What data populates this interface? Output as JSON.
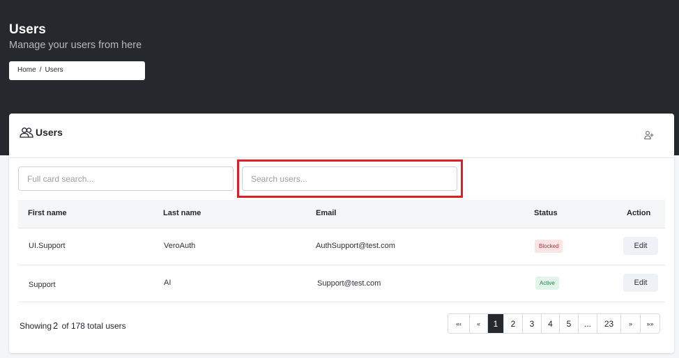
{
  "header": {
    "title": "Users",
    "subtitle": "Manage your users from here",
    "breadcrumb": {
      "home": "Home",
      "separator": "/",
      "current": "Users"
    }
  },
  "card": {
    "title": "Users",
    "card_search_placeholder": "Full card search...",
    "user_search_placeholder": "Search users..."
  },
  "table": {
    "columns": {
      "first_name": "First name",
      "last_name": "Last name",
      "email": "Email",
      "status": "Status",
      "action": "Action"
    },
    "rows": [
      {
        "first_name": "UI.Support",
        "last_name": "VeroAuth",
        "email": "AuthSupport@test.com",
        "status": "Blocked",
        "action": "Edit"
      },
      {
        "first_name": "Support",
        "last_name": "AI",
        "email": "Support@test.com",
        "status": "Active",
        "action": "Edit"
      }
    ]
  },
  "footer": {
    "showing_label": "Showing",
    "shown_count": "2",
    "total_text": "of 178 total users"
  },
  "pagination": {
    "first": "«‹",
    "prev": "«",
    "pages": [
      "1",
      "2",
      "3",
      "4",
      "5",
      "...",
      "23"
    ],
    "current": "1",
    "next": "»",
    "last": "»»"
  },
  "colors": {
    "header_bg": "#25282c",
    "highlight_border": "#e01e26",
    "blocked_badge_bg": "#fbe4e4",
    "active_badge_bg": "#e2f5ea",
    "active_page_bg": "#25282c"
  },
  "icons": {
    "card_icon": "users-icon",
    "add_user_icon": "user-plus-icon"
  }
}
